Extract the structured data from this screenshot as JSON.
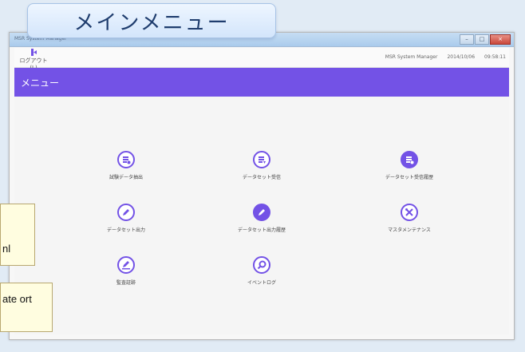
{
  "banner": {
    "title": "メインメニュー"
  },
  "window": {
    "titlebar": "MSR System Manager"
  },
  "appbar": {
    "logout_label": "ログアウト(L)",
    "app_name": "MSR System Manager",
    "date": "2014/10/06",
    "time": "09:58:11"
  },
  "header": {
    "title": "メニュー"
  },
  "menu": {
    "items": [
      {
        "label": "試験データ抽出",
        "icon": "data-extract-icon"
      },
      {
        "label": "データセット受信",
        "icon": "dataset-receive-icon"
      },
      {
        "label": "データセット受信履歴",
        "icon": "dataset-receive-history-icon"
      },
      {
        "label": "データセット出力",
        "icon": "dataset-output-icon"
      },
      {
        "label": "データセット出力履歴",
        "icon": "dataset-output-history-icon"
      },
      {
        "label": "マスタメンテナンス",
        "icon": "master-maintenance-icon"
      },
      {
        "label": "監査証跡",
        "icon": "audit-trail-icon"
      },
      {
        "label": "イベントログ",
        "icon": "event-log-icon"
      }
    ]
  },
  "callouts": [
    {
      "text": "nl"
    },
    {
      "text": "ate ort"
    }
  ],
  "colors": {
    "accent": "#7352e6",
    "banner_text": "#1f3d6e"
  }
}
